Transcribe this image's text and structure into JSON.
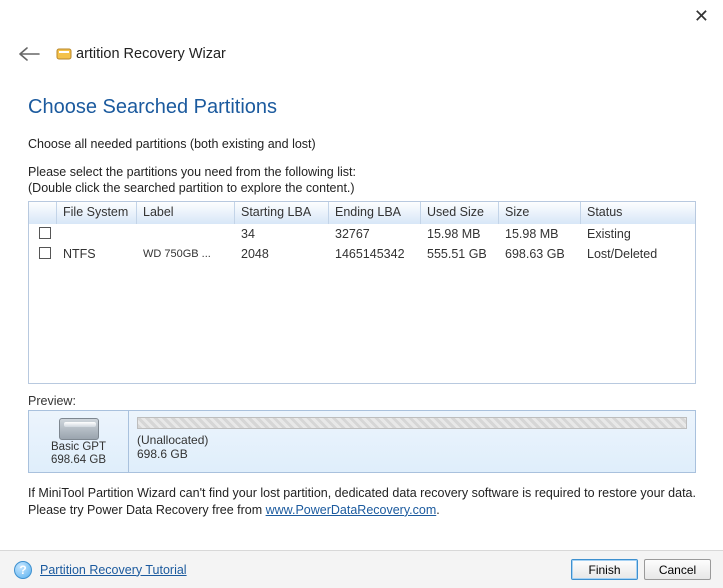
{
  "window": {
    "title": "artition Recovery Wizar",
    "close_glyph": "✕"
  },
  "heading": "Choose Searched Partitions",
  "instruction_main": "Choose all needed partitions (both existing and lost)",
  "instruction_line1": "Please select the partitions you need from the following list:",
  "instruction_line2": "(Double click the searched partition to explore the content.)",
  "columns": {
    "fs": "File System",
    "label": "Label",
    "slba": "Starting LBA",
    "elba": "Ending LBA",
    "used": "Used Size",
    "size": "Size",
    "status": "Status"
  },
  "rows": [
    {
      "fs": "",
      "label": "",
      "slba": "34",
      "elba": "32767",
      "used": "15.98 MB",
      "size": "15.98 MB",
      "status": "Existing"
    },
    {
      "fs": "NTFS",
      "label": "WD 750GB ...",
      "slba": "2048",
      "elba": "1465145342",
      "used": "555.51 GB",
      "size": "698.63 GB",
      "status": "Lost/Deleted"
    }
  ],
  "preview": {
    "label": "Preview:",
    "disk_type": "Basic GPT",
    "disk_size": "698.64 GB",
    "segment_name": "(Unallocated)",
    "segment_size": "698.6 GB"
  },
  "note": {
    "text1": "If MiniTool Partition Wizard can't find your lost partition, dedicated data recovery software is required to restore your data. Please try Power Data Recovery free from ",
    "link_text": "www.PowerDataRecovery.com",
    "link_url": "http://www.PowerDataRecovery.com",
    "text2": "."
  },
  "footer": {
    "tutorial": "Partition Recovery Tutorial",
    "finish": "Finish",
    "cancel": "Cancel",
    "help_glyph": "?"
  }
}
